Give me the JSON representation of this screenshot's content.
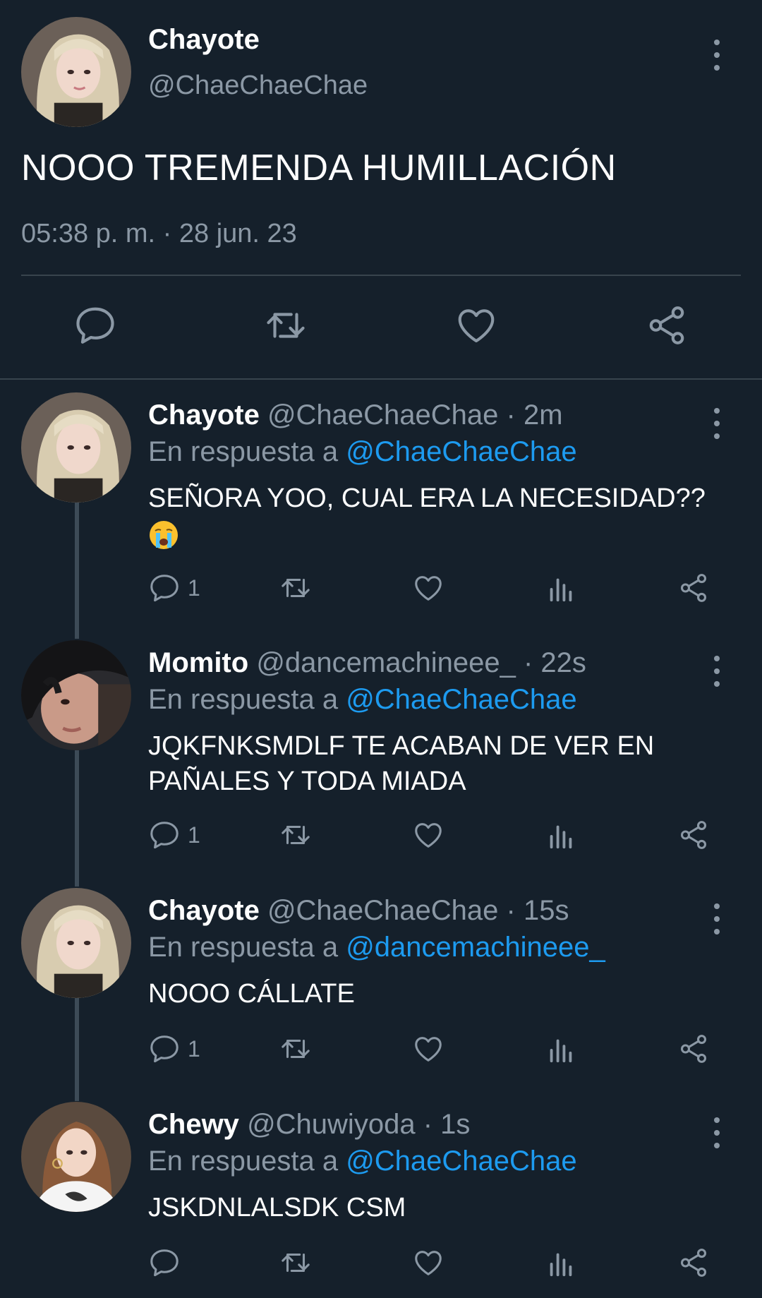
{
  "main_tweet": {
    "name": "Chayote",
    "handle": "@ChaeChaeChae",
    "text": "NOOO TREMENDA HUMILLACIÓN",
    "timestamp": "05:38 p. m. · 28 jun. 23",
    "actions": [
      "reply-icon",
      "retweet-icon",
      "like-icon",
      "share-icon"
    ]
  },
  "replies": [
    {
      "name": "Chayote",
      "handle": "@ChaeChaeChae",
      "time": "· 2m",
      "in_reply_prefix": "En respuesta a",
      "in_reply_to": "@ChaeChaeChae",
      "text": "SEÑORA YOO, CUAL ERA LA NECESIDAD??",
      "emoji": "loudly-crying-face-icon",
      "reply_count": "1"
    },
    {
      "name": "Momito",
      "handle": "@dancemachineee_",
      "time": "· 22s",
      "in_reply_prefix": "En respuesta a",
      "in_reply_to": "@ChaeChaeChae",
      "text": "JQKFNKSMDLF TE ACABAN DE VER EN PAÑALES Y TODA MIADA",
      "reply_count": "1"
    },
    {
      "name": "Chayote",
      "handle": "@ChaeChaeChae",
      "time": "· 15s",
      "in_reply_prefix": "En respuesta a",
      "in_reply_to": "@dancemachineee_",
      "text": "NOOO CÁLLATE",
      "reply_count": "1"
    },
    {
      "name": "Chewy",
      "handle": "@Chuwiyoda",
      "time": "· 1s",
      "in_reply_prefix": "En respuesta a",
      "in_reply_to": "@ChaeChaeChae",
      "text": "JSKDNLALSDK CSM",
      "reply_count": ""
    }
  ],
  "colors": {
    "background": "#15202b",
    "secondary_text": "#8b98a5",
    "mention": "#1d9bf0",
    "divider": "#38444d"
  }
}
